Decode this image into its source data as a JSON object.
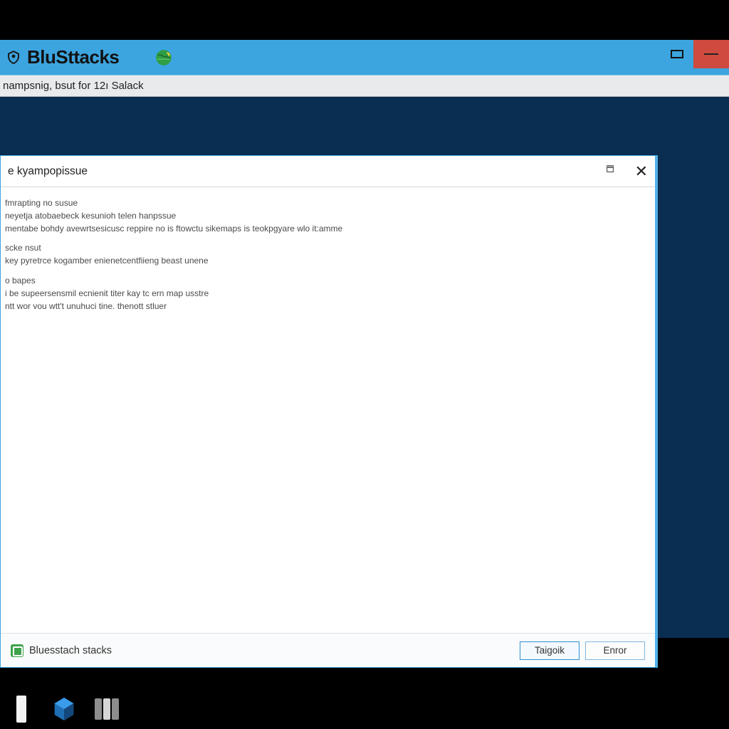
{
  "app": {
    "brand": "BluSttacks",
    "toolbar_text": "nampsnig, bsut for 12ı Salack"
  },
  "dialog": {
    "title": "e kyampopissue",
    "body_lines": [
      "fmrapting no susue",
      "neyetja atobaebeck kesunioh telen hanpssue",
      "mentabe bohdy avewrtsesicusc reppire no is ftowctu sikemaps is teokpgyare wlo it:amme",
      "",
      "scke nsut",
      "key pyretrce kogamber enienetcentfiieng beast unene",
      "",
      "o bapes",
      "i be supeersensmil ecnienit titer kay tc ern map usstre",
      "ntt wor vou wtt't unuhuci tine. thenott stluer"
    ],
    "footer_label": "Bluesstach stacks",
    "primary_btn": "Taigoik",
    "secondary_btn": "Enror"
  }
}
